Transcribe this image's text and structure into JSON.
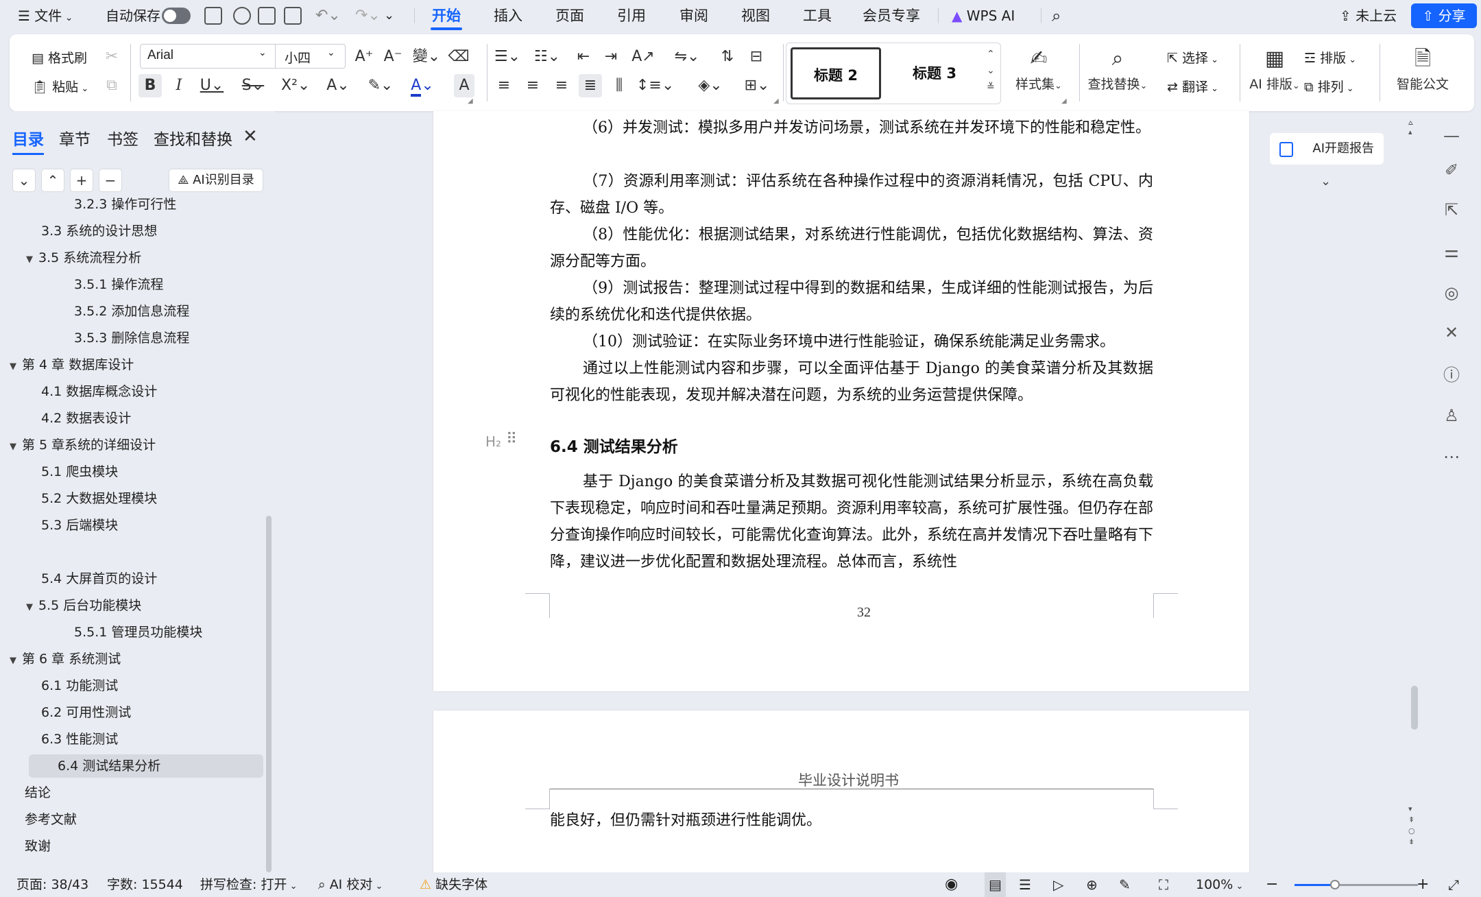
{
  "menubar": {
    "file_label": "文件",
    "autosave_label": "自动保存",
    "tabs": [
      "开始",
      "插入",
      "页面",
      "引用",
      "审阅",
      "视图",
      "工具",
      "会员专享"
    ],
    "active_tab": "开始",
    "wps_ai_label": "WPS AI",
    "cloud_label": "未上云",
    "share_label": "分享",
    "accent_color": "#1664ff"
  },
  "ribbon": {
    "format_painter": "格式刷",
    "paste": "粘贴",
    "font_name": "Arial",
    "font_size": "小四",
    "styles": [
      "标题 2",
      "标题 3"
    ],
    "style_set": "样式集",
    "find_replace": "查找替换",
    "select": "选择",
    "translate": "翻译",
    "ai_layout": "AI 排版",
    "layout": "排版",
    "arrange": "排列",
    "smart_doc": "智能公文"
  },
  "nav": {
    "tabs": [
      "目录",
      "章节",
      "书签",
      "查找和替换"
    ],
    "ai_toc_label": "AI识别目录",
    "toc": [
      {
        "label": "3.2.3 操作可行性",
        "level": 3,
        "caret": false
      },
      {
        "label": "3.3 系统的设计思想",
        "level": 2,
        "caret": false
      },
      {
        "label": "3.5 系统流程分析",
        "level": 2,
        "caret": true
      },
      {
        "label": "3.5.1 操作流程",
        "level": 3,
        "caret": false
      },
      {
        "label": "3.5.2 添加信息流程",
        "level": 3,
        "caret": false
      },
      {
        "label": "3.5.3 删除信息流程",
        "level": 3,
        "caret": false
      },
      {
        "label": "第 4 章 数据库设计",
        "level": 1,
        "caret": true
      },
      {
        "label": "4.1 数据库概念设计",
        "level": 2,
        "caret": false
      },
      {
        "label": "4.2 数据表设计",
        "level": 2,
        "caret": false
      },
      {
        "label": "第 5 章系统的详细设计",
        "level": 1,
        "caret": true
      },
      {
        "label": "5.1 爬虫模块",
        "level": 2,
        "caret": false
      },
      {
        "label": "5.2 大数据处理模块",
        "level": 2,
        "caret": false
      },
      {
        "label": "5.3 后端模块",
        "level": 2,
        "caret": false
      },
      {
        "label": "",
        "level": 2,
        "caret": false
      },
      {
        "label": "5.4 大屏首页的设计",
        "level": 2,
        "caret": false
      },
      {
        "label": "5.5 后台功能模块",
        "level": 2,
        "caret": true
      },
      {
        "label": "5.5.1 管理员功能模块",
        "level": 3,
        "caret": false
      },
      {
        "label": "第 6 章 系统测试",
        "level": 1,
        "caret": true
      },
      {
        "label": "6.1 功能测试",
        "level": 2,
        "caret": false
      },
      {
        "label": "6.2 可用性测试",
        "level": 2,
        "caret": false
      },
      {
        "label": "6.3 性能测试",
        "level": 2,
        "caret": false
      },
      {
        "label": "6.4 测试结果分析",
        "level": 2,
        "caret": false,
        "selected": true
      },
      {
        "label": "结论",
        "level": 1,
        "caret": false
      },
      {
        "label": "参考文献",
        "level": 1,
        "caret": false
      },
      {
        "label": "致谢",
        "level": 1,
        "caret": false
      }
    ]
  },
  "document": {
    "page1_paragraphs": [
      "（6）并发测试：模拟多用户并发访问场景，测试系统在并发环境下的性能和稳定性。",
      "（7）资源利用率测试：评估系统在各种操作过程中的资源消耗情况，包括 CPU、内存、磁盘 I/O 等。",
      "（8）性能优化：根据测试结果，对系统进行性能调优，包括优化数据结构、算法、资源分配等方面。",
      "（9）测试报告：整理测试过程中得到的数据和结果，生成详细的性能测试报告，为后续的系统优化和迭代提供依据。",
      "（10）测试验证：在实际业务环境中进行性能验证，确保系统能满足业务需求。",
      "通过以上性能测试内容和步骤，可以全面评估基于 Django 的美食菜谱分析及其数据可视化的性能表现，发现并解决潜在问题，为系统的业务运营提供保障。"
    ],
    "heading_64": "6.4 测试结果分析",
    "page1_analysis": "基于 Django 的美食菜谱分析及其数据可视化性能测试结果分析显示，系统在高负载下表现稳定，响应时间和吞吐量满足预期。资源利用率较高，系统可扩展性强。但仍存在部分查询操作响应时间较长，可能需优化查询算法。此外，系统在高并发情况下吞吐量略有下降，建议进一步优化配置和数据处理流程。总体而言，系统性",
    "page_number": "32",
    "page2_header": "毕业设计说明书",
    "page2_text": "能良好，但仍需针对瓶颈进行性能调优。",
    "heading_marker": "H₂"
  },
  "right_panel": {
    "ai_report_label": "AI开题报告"
  },
  "statusbar": {
    "page": "页面: 38/43",
    "word_count": "字数: 15544",
    "spell_check": "拼写检查: 打开",
    "ai_proofread": "AI 校对",
    "missing_font": "缺失字体",
    "zoom": "100%",
    "zoom_level": 0.33
  }
}
